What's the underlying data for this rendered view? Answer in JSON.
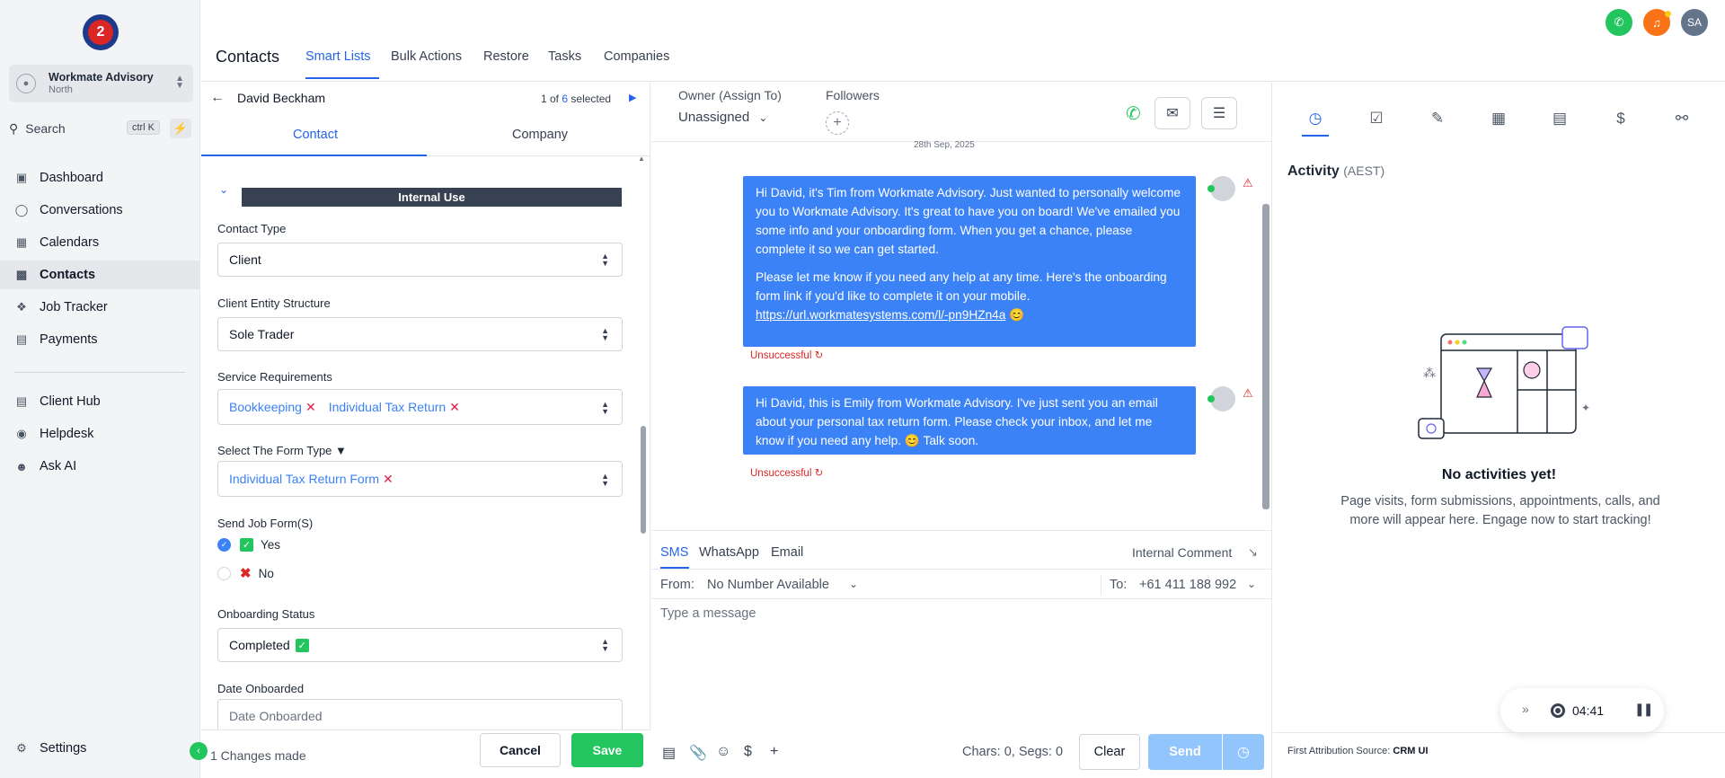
{
  "sidebar": {
    "logo_letter": "2",
    "account": {
      "name": "Workmate Advisory",
      "sub": "North"
    },
    "search": {
      "label": "Search",
      "shortcut": "ctrl K"
    },
    "items": [
      {
        "label": "Dashboard",
        "icon": "dashboard-icon"
      },
      {
        "label": "Conversations",
        "icon": "chat-icon"
      },
      {
        "label": "Calendars",
        "icon": "calendar-icon"
      },
      {
        "label": "Contacts",
        "icon": "contacts-icon",
        "active": true
      },
      {
        "label": "Job Tracker",
        "icon": "job-tracker-icon"
      },
      {
        "label": "Payments",
        "icon": "payments-icon"
      }
    ],
    "items2": [
      {
        "label": "Client Hub",
        "icon": "client-hub-icon"
      },
      {
        "label": "Helpdesk",
        "icon": "helpdesk-icon"
      },
      {
        "label": "Ask AI",
        "icon": "ask-ai-icon"
      }
    ],
    "settings_label": "Settings"
  },
  "header": {
    "title": "Contacts",
    "tabs": [
      "Smart Lists",
      "Bulk Actions",
      "Restore",
      "Tasks",
      "Companies"
    ],
    "avatar_initials": "SA",
    "colors": {
      "call": "#22c55e",
      "notify": "#f97316",
      "avatar": "#64748b"
    }
  },
  "contact": {
    "name": "David Beckham",
    "pager": {
      "current": "1 of",
      "total": "6",
      "suffix": "selected"
    },
    "tabs": [
      "Contact",
      "Company"
    ],
    "section_title": "Internal Use",
    "fields": {
      "contact_type": {
        "label": "Contact Type",
        "value": "Client"
      },
      "entity_structure": {
        "label": "Client Entity Structure",
        "value": "Sole Trader"
      },
      "service_requirements": {
        "label": "Service Requirements",
        "chips": [
          "Bookkeeping",
          "Individual Tax Return"
        ]
      },
      "form_type": {
        "label": "Select The Form Type ▼",
        "chips": [
          "Individual Tax Return Form"
        ]
      },
      "send_job_forms": {
        "label": "Send Job Form(S)",
        "options": [
          "Yes",
          "No"
        ],
        "selected": "Yes"
      },
      "onboarding_status": {
        "label": "Onboarding Status",
        "value": "Completed"
      },
      "date_onboarded": {
        "label": "Date Onboarded",
        "placeholder": "Date Onboarded"
      }
    },
    "footer": {
      "changes": "1 Changes made",
      "cancel": "Cancel",
      "save": "Save"
    }
  },
  "conversation": {
    "owner_label": "Owner (Assign To)",
    "owner_value": "Unassigned",
    "followers_label": "Followers",
    "date": "28th Sep, 2025",
    "messages": [
      {
        "p1": "Hi David, it's Tim from Workmate Advisory. Just wanted to personally welcome you to Workmate Advisory. It's great to have you on board! We've emailed you some info and your onboarding form. When you get a chance, please complete it so we can get started.",
        "p2": "Please let me know if you need any help at any time. Here's the onboarding form link if you'd like to complete it on your mobile.",
        "link": "https://url.workmatesystems.com/l/-pn9HZn4a",
        "emoji": "😊",
        "status": "Unsuccessful"
      },
      {
        "p1": "Hi David, this is Emily from Workmate Advisory. I've just sent you an email about your personal tax return form. Please check your inbox, and let me know if you need any help. 😊 Talk soon.",
        "status": "Unsuccessful"
      }
    ],
    "compose": {
      "channels": [
        "SMS",
        "WhatsApp",
        "Email"
      ],
      "internal_comment": "Internal Comment",
      "from_label": "From:",
      "from_value": "No Number Available",
      "to_label": "To:",
      "to_value": "+61 411 188 992",
      "placeholder": "Type a message",
      "chars": "Chars: 0, Segs: 0",
      "clear": "Clear",
      "send": "Send"
    }
  },
  "activity": {
    "title": "Activity",
    "timezone": "(AEST)",
    "empty_title": "No activities yet!",
    "empty_sub": "Page visits, form submissions, appointments, calls, and more will appear here. Engage now to start tracking!",
    "recorder_time": "04:41",
    "attribution_label": "First Attribution Source:",
    "attribution_value": "CRM UI"
  }
}
